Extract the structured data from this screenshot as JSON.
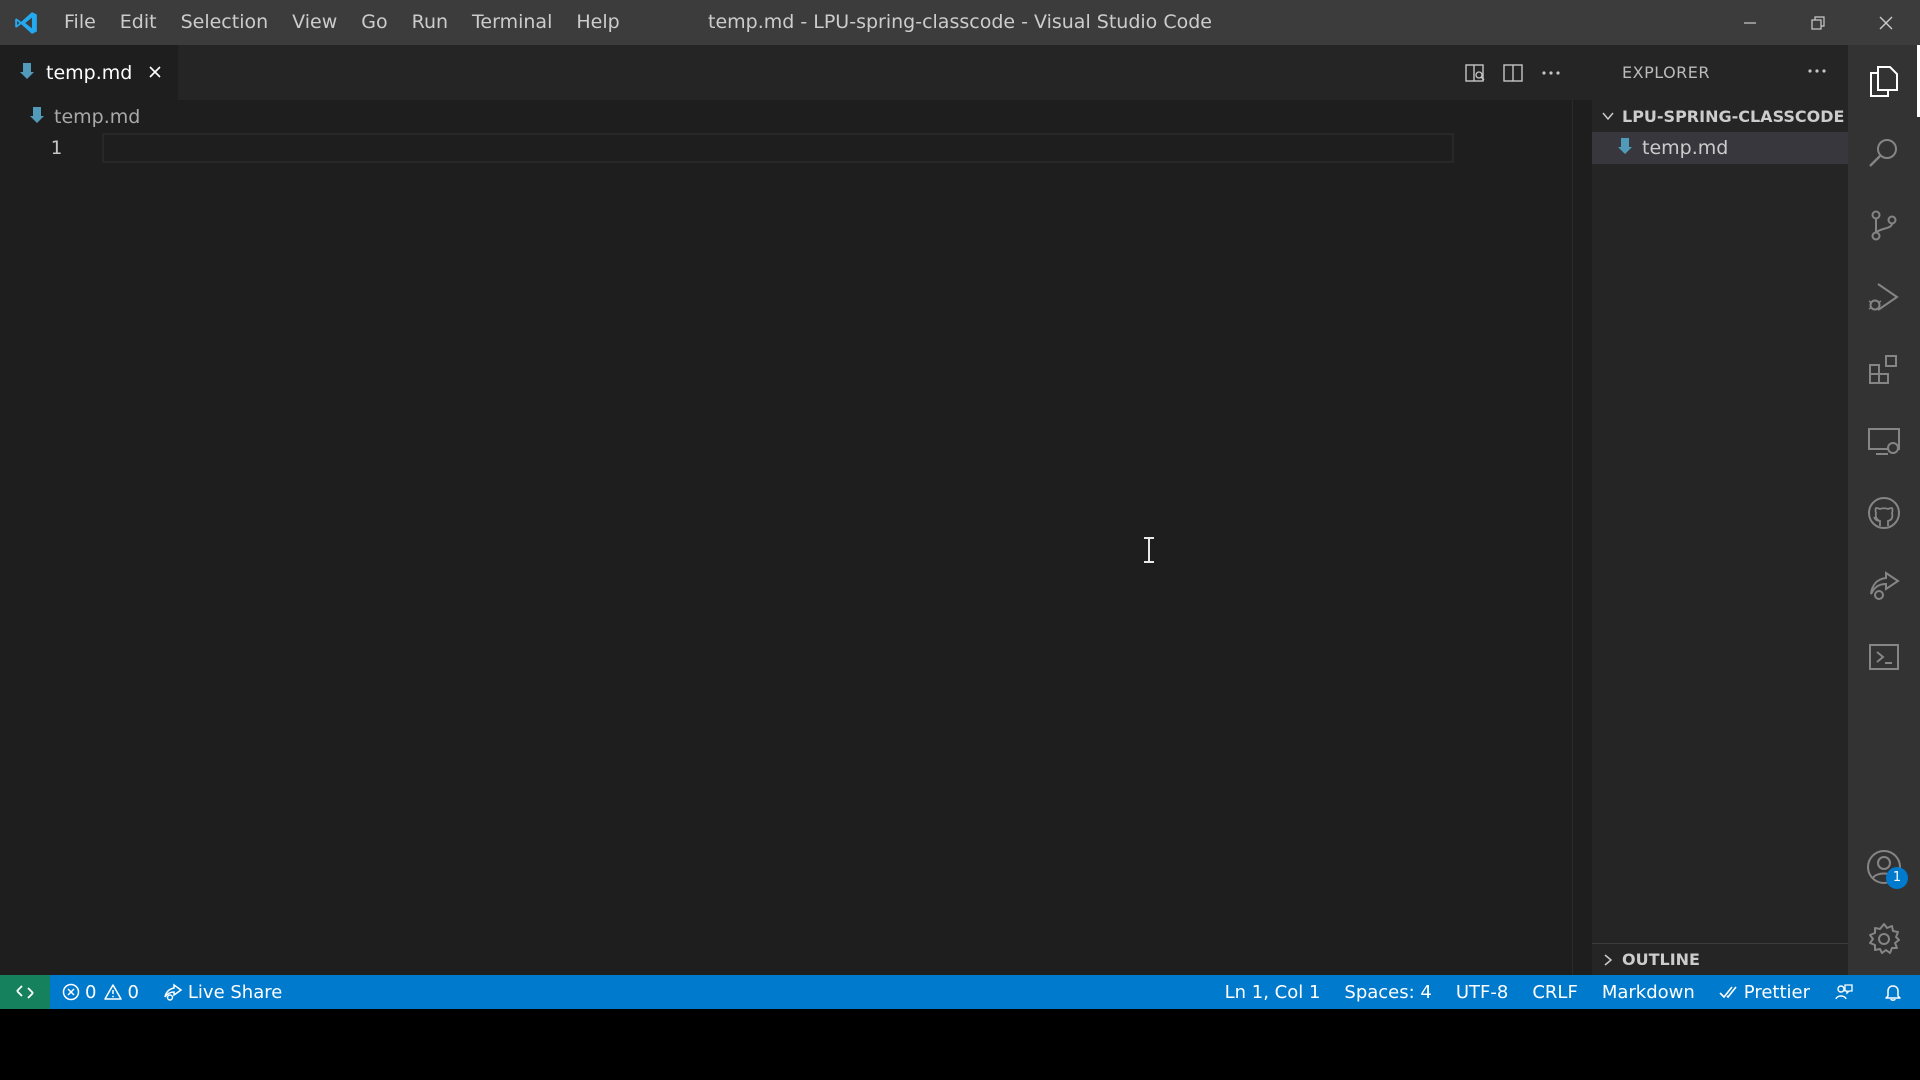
{
  "titlebar": {
    "menu": [
      "File",
      "Edit",
      "Selection",
      "View",
      "Go",
      "Run",
      "Terminal",
      "Help"
    ],
    "title": "temp.md - LPU-spring-classcode - Visual Studio Code"
  },
  "editor": {
    "tab": {
      "label": "temp.md"
    },
    "breadcrumb": "temp.md",
    "line_numbers": [
      "1"
    ]
  },
  "explorer": {
    "title": "EXPLORER",
    "folder": "LPU-SPRING-CLASSCODE",
    "files": [
      "temp.md"
    ],
    "outline": "OUTLINE"
  },
  "activitybar": {
    "icons": [
      "files-icon",
      "search-icon",
      "source-control-icon",
      "run-debug-icon",
      "extensions-icon",
      "remote-explorer-icon",
      "github-icon",
      "live-share-icon",
      "terminal-icon",
      "account-icon",
      "settings-gear-icon"
    ],
    "account_badge": "1"
  },
  "statusbar": {
    "errors": "0",
    "warnings": "0",
    "live_share": "Live Share",
    "position": "Ln 1, Col 1",
    "spaces": "Spaces: 4",
    "encoding": "UTF-8",
    "eol": "CRLF",
    "language": "Markdown",
    "prettier": "Prettier"
  },
  "colors": {
    "accent": "#007acc",
    "titlebar": "#3c3c3c",
    "editor_bg": "#1e1e1e",
    "sidebar_bg": "#252526",
    "activitybar_bg": "#333333",
    "markdown_icon": "#519aba"
  }
}
